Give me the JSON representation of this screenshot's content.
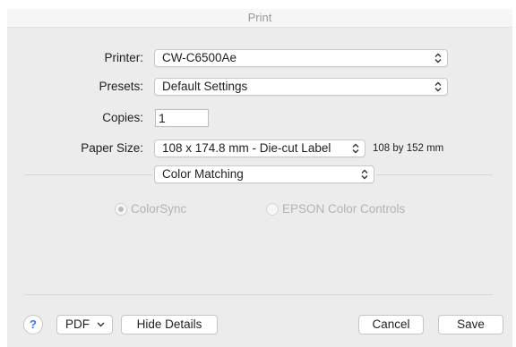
{
  "window": {
    "title": "Print"
  },
  "printer": {
    "label": "Printer:",
    "value": "CW-C6500Ae"
  },
  "presets": {
    "label": "Presets:",
    "value": "Default Settings"
  },
  "copies": {
    "label": "Copies:",
    "value": "1"
  },
  "paper_size": {
    "label": "Paper Size:",
    "value": "108 x 174.8 mm - Die-cut Label",
    "dimensions": "108 by 152 mm"
  },
  "panel": {
    "value": "Color Matching"
  },
  "color_options": [
    {
      "label": "ColorSync",
      "selected": true,
      "enabled": false
    },
    {
      "label": "EPSON Color Controls",
      "selected": false,
      "enabled": false
    }
  ],
  "footer": {
    "help": "?",
    "pdf": "PDF",
    "hide_details": "Hide Details",
    "cancel": "Cancel",
    "save": "Save"
  }
}
